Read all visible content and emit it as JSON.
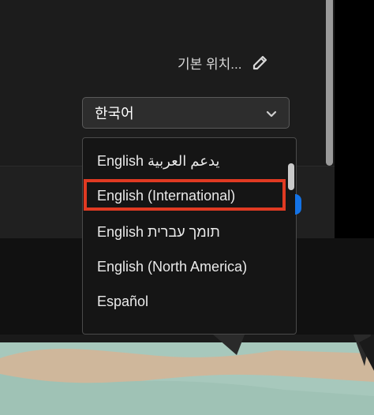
{
  "location": {
    "label": "기본 위치...",
    "edit_icon": "pencil-icon"
  },
  "language_select": {
    "value": "한국어",
    "icon": "chevron-down-icon"
  },
  "dropdown": {
    "options": [
      "English يدعم العربية",
      "English (International)",
      "English תומך עברית",
      "English (North America)",
      "Español"
    ],
    "highlighted_index": 1,
    "highlight_color": "#e03a22"
  },
  "colors": {
    "panel": "#1c1c1c",
    "accent_blue": "#1473e6"
  }
}
